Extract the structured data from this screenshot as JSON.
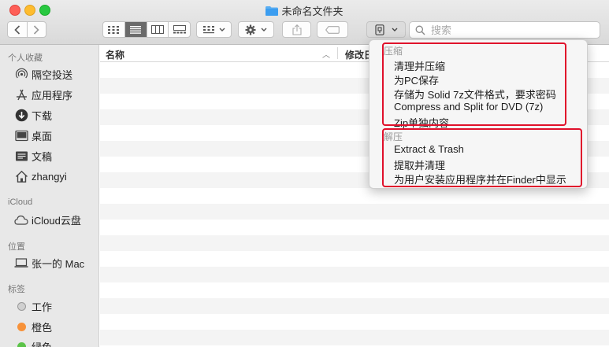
{
  "window": {
    "title": "未命名文件夹"
  },
  "toolbar": {
    "search_placeholder": "搜索"
  },
  "sidebar": {
    "favorites_header": "个人收藏",
    "favorites": [
      {
        "label": "隔空投送",
        "icon": "airdrop-icon"
      },
      {
        "label": "应用程序",
        "icon": "applications-icon"
      },
      {
        "label": "下载",
        "icon": "downloads-icon"
      },
      {
        "label": "桌面",
        "icon": "desktop-icon"
      },
      {
        "label": "文稿",
        "icon": "documents-icon"
      },
      {
        "label": "zhangyi",
        "icon": "home-icon"
      }
    ],
    "icloud_header": "iCloud",
    "icloud": [
      {
        "label": "iCloud云盘",
        "icon": "cloud-icon"
      }
    ],
    "locations_header": "位置",
    "locations": [
      {
        "label": "张一的 Mac",
        "icon": "laptop-icon"
      }
    ],
    "tags_header": "标签",
    "tags": [
      {
        "label": "工作",
        "color": "#d0d0d0"
      },
      {
        "label": "橙色",
        "color": "#f7923a"
      },
      {
        "label": "绿色",
        "color": "#5bc348"
      }
    ]
  },
  "list": {
    "columns": [
      "名称",
      "修改日"
    ]
  },
  "menu": {
    "compress_header": "压缩",
    "compress_items": [
      "清理并压缩",
      "为PC保存",
      "存储为 Solid 7z文件格式，要求密码",
      "Compress and Split for DVD (7z)",
      "Zip单独内容"
    ],
    "extract_header": "解压",
    "extract_items": [
      "Extract & Trash",
      "提取并清理",
      "为用户安装应用程序并在Finder中显示"
    ],
    "highlight_color": "#e0102b"
  }
}
